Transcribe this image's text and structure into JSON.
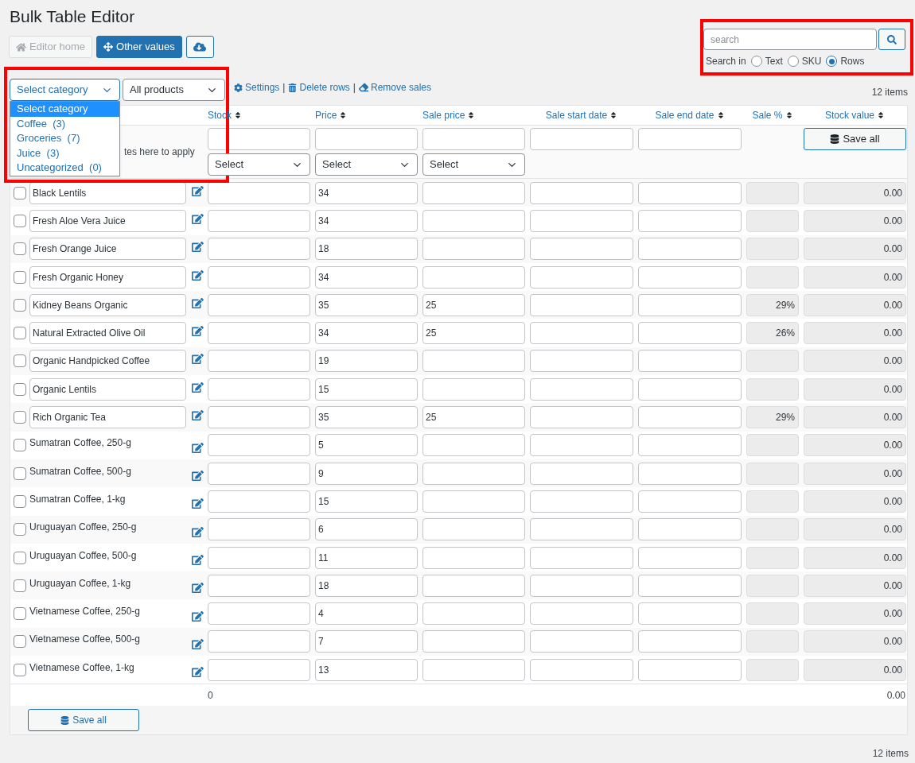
{
  "title": "Bulk Table Editor",
  "toolbar": [
    {
      "kind": "default",
      "label": "Editor home",
      "disabled": true
    },
    {
      "kind": "primary",
      "label": "Other values",
      "disabled": false
    },
    {
      "kind": "icon",
      "disabled": false
    }
  ],
  "search": {
    "placeholder": "search",
    "search_in_label": "Search in",
    "options": [
      {
        "label": "Text",
        "selected": false
      },
      {
        "label": "SKU",
        "selected": false
      },
      {
        "label": "Rows",
        "selected": true
      }
    ]
  },
  "filters": {
    "category_select": {
      "value": "Select category",
      "focused": true
    },
    "products_select": {
      "value": "All products"
    },
    "links": [
      "Settings",
      "Delete rows",
      "Remove sales"
    ],
    "separator": "|"
  },
  "category_dropdown": [
    {
      "label": "Select category",
      "selected": true
    },
    {
      "label": "Coffee  (3)",
      "selected": false
    },
    {
      "label": "Groceries  (7)",
      "selected": false
    },
    {
      "label": "Juice  (3)",
      "selected": false
    },
    {
      "label": "Uncategorized  (0)",
      "selected": false
    }
  ],
  "items_count_top": "12 items",
  "columns": [
    "Stock",
    "Price",
    "Sale price",
    "Sale start date",
    "Sale end date",
    "Sale %",
    "Stock value"
  ],
  "bulk_row": {
    "note": "tes here to apply",
    "selects": [
      "Select",
      "Select",
      "Select"
    ],
    "save_all": "Save all"
  },
  "rows": [
    {
      "kind": "field",
      "name": "Black Lentils",
      "checked": false,
      "price": "34",
      "stock_value": "0.00"
    },
    {
      "kind": "field",
      "name": "Fresh Aloe Vera Juice",
      "checked": false,
      "price": "34",
      "stock_value": "0.00"
    },
    {
      "kind": "field",
      "name": "Fresh Orange Juice",
      "checked": false,
      "price": "18",
      "stock_value": "0.00"
    },
    {
      "kind": "field",
      "name": "Fresh Organic Honey",
      "checked": false,
      "price": "34",
      "stock_value": "0.00"
    },
    {
      "kind": "field",
      "name": "Kidney Beans Organic",
      "checked": false,
      "price": "35",
      "sale_price": "25",
      "sale_pct": "29%",
      "stock_value": "0.00"
    },
    {
      "kind": "field",
      "name": "Natural Extracted Olive Oil",
      "checked": false,
      "price": "34",
      "sale_price": "25",
      "sale_pct": "26%",
      "stock_value": "0.00"
    },
    {
      "kind": "field",
      "name": "Organic Handpicked Coffee",
      "checked": false,
      "price": "19",
      "stock_value": "0.00"
    },
    {
      "kind": "field",
      "name": "Organic Lentils",
      "checked": false,
      "price": "15",
      "stock_value": "0.00"
    },
    {
      "kind": "field",
      "name": "Rich Organic Tea",
      "checked": false,
      "price": "35",
      "sale_price": "25",
      "sale_pct": "29%",
      "stock_value": "0.00"
    },
    {
      "kind": "text",
      "name": "Sumatran Coffee, 250-g",
      "checked": false,
      "price": "5",
      "stock_value": "0.00"
    },
    {
      "kind": "text",
      "name": "Sumatran Coffee, 500-g",
      "checked": false,
      "price": "9",
      "stock_value": "0.00"
    },
    {
      "kind": "text",
      "name": "Sumatran Coffee, 1-kg",
      "checked": false,
      "price": "15",
      "stock_value": "0.00"
    },
    {
      "kind": "text",
      "name": "Uruguayan Coffee, 250-g",
      "checked": false,
      "price": "6",
      "stock_value": "0.00"
    },
    {
      "kind": "text",
      "name": "Uruguayan Coffee, 500-g",
      "checked": false,
      "price": "11",
      "stock_value": "0.00"
    },
    {
      "kind": "text",
      "name": "Uruguayan Coffee, 1-kg",
      "checked": false,
      "price": "18",
      "stock_value": "0.00"
    },
    {
      "kind": "text",
      "name": "Vietnamese Coffee, 250-g",
      "checked": false,
      "price": "4",
      "stock_value": "0.00"
    },
    {
      "kind": "text",
      "name": "Vietnamese Coffee, 500-g",
      "checked": false,
      "price": "7",
      "stock_value": "0.00"
    },
    {
      "kind": "text",
      "name": "Vietnamese Coffee, 1-kg",
      "checked": false,
      "price": "13",
      "stock_value": "0.00"
    }
  ],
  "totals": {
    "stock": "0",
    "stock_value": "0.00"
  },
  "bottom_save": "Save all",
  "items_count_bottom": "12 items"
}
